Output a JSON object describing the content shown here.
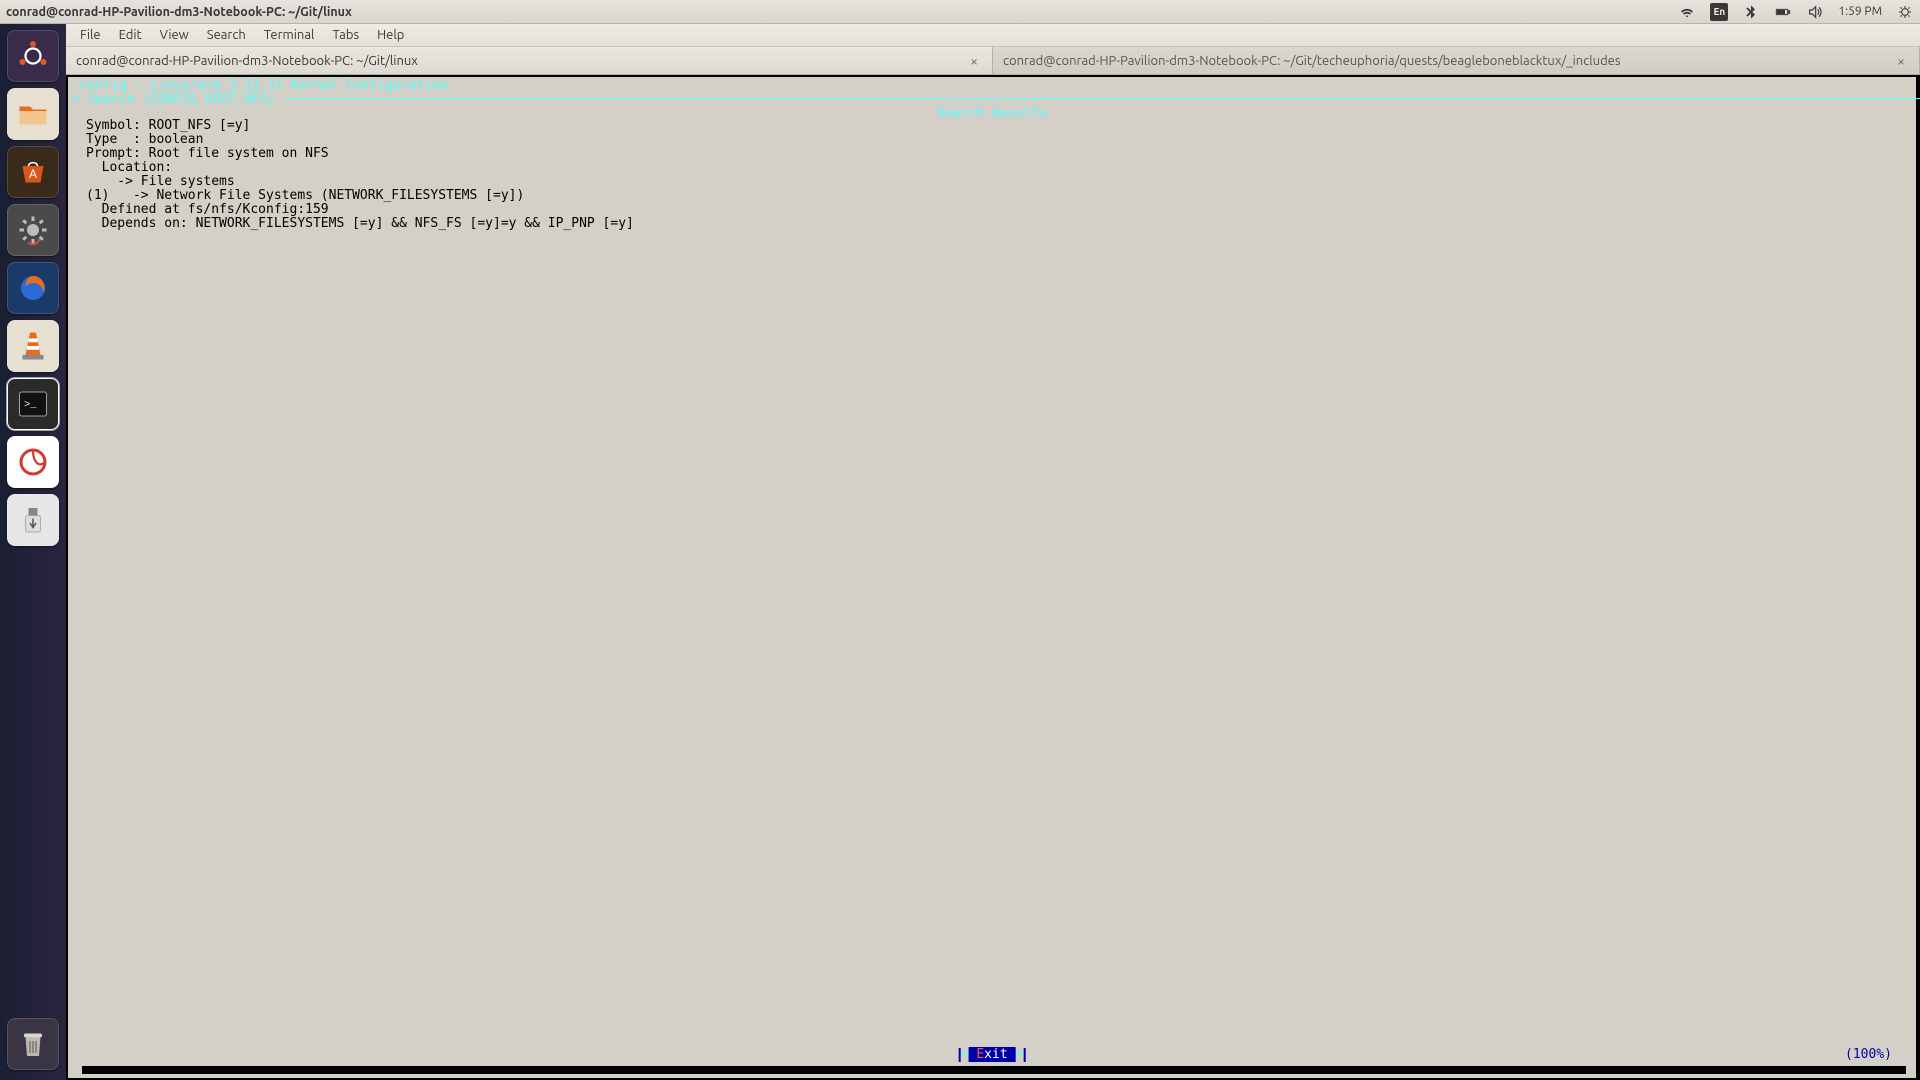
{
  "topbar": {
    "title": "conrad@conrad-HP-Pavilion-dm3-Notebook-PC: ~/Git/linux",
    "lang": "En",
    "time": "1:59 PM"
  },
  "launcher": {
    "items": [
      {
        "name": "dash-icon",
        "bg": "#3b2b4a"
      },
      {
        "name": "files-icon",
        "bg": "#e46e1f"
      },
      {
        "name": "software-center-icon",
        "bg": "#d9571a"
      },
      {
        "name": "settings-icon",
        "bg": "#3a3a3a"
      },
      {
        "name": "firefox-icon",
        "bg": "#0a84ff"
      },
      {
        "name": "vlc-icon",
        "bg": "#e46e1f"
      },
      {
        "name": "terminal-icon",
        "bg": "#2b2b2b"
      },
      {
        "name": "pdf-reader-icon",
        "bg": "#d4392e"
      },
      {
        "name": "usb-device-icon",
        "bg": "#e6e6e6"
      }
    ],
    "trash": {
      "name": "trash-icon"
    }
  },
  "menubar": [
    "File",
    "Edit",
    "View",
    "Search",
    "Terminal",
    "Tabs",
    "Help"
  ],
  "tabs": [
    {
      "label": "conrad@conrad-HP-Pavilion-dm3-Notebook-PC: ~/Git/linux",
      "active": true
    },
    {
      "label": "conrad@conrad-HP-Pavilion-dm3-Notebook-PC: ~/Git/techeuphoria/quests/beagleboneblacktux/_includes",
      "active": false
    }
  ],
  "kconfig": {
    "header": ".config - Linux/arm 3.13.11 Kernel Configuration",
    "subheader": "> Search (CONFIG_ROOT_NFS) ",
    "search_results_title": "Search Results",
    "body": "Symbol: ROOT_NFS [=y]\nType  : boolean\nPrompt: Root file system on NFS\n  Location:\n    -> File systems\n(1)   -> Network File Systems (NETWORK_FILESYSTEMS [=y])\n  Defined at fs/nfs/Kconfig:159\n  Depends on: NETWORK_FILESYSTEMS [=y] && NFS_FS [=y]=y && IP_PNP [=y]",
    "exit_label": "Exit",
    "percent": "(100%)"
  }
}
